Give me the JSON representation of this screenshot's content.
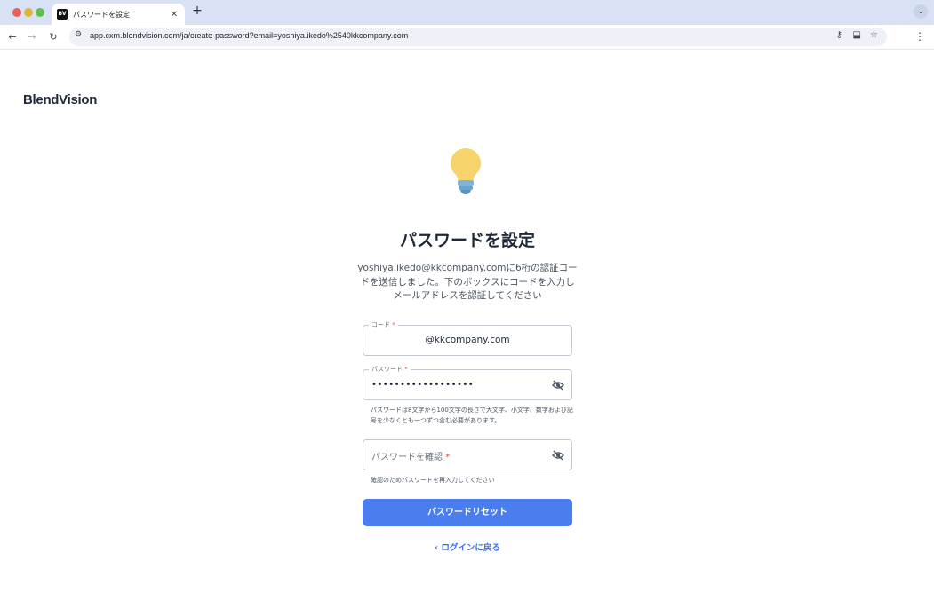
{
  "browser": {
    "tab_title": "パスワードを設定",
    "favicon_text": "BV",
    "url": "app.cxm.blendvision.com/ja/create-password?email=yoshiya.ikedo%2540kkcompany.com"
  },
  "page": {
    "logo": "BlendVision",
    "title": "パスワードを設定",
    "description": "yoshiya.ikedo@kkcompany.comに6桁の認証コードを送信しました。下のボックスにコードを入力しメールアドレスを認証してください",
    "code_field": {
      "label": "コード",
      "value": "@kkcompany.com"
    },
    "password_field": {
      "label": "パスワード",
      "value": "••••••••••••••••••",
      "helper": "パスワードは8文字から100文字の長さで大文字、小文字、数字および記号を少なくとも一つずつ含む必要があります。"
    },
    "confirm_field": {
      "placeholder": "パスワードを確認",
      "helper": "確認のためパスワードを再入力してください"
    },
    "submit_label": "パスワードリセット",
    "back_link": "ログインに戻る"
  },
  "icons": [
    "close-icon",
    "plus-icon",
    "back-arrow-icon",
    "forward-arrow-icon",
    "reload-icon",
    "site-settings-icon",
    "key-icon",
    "install-icon",
    "star-icon",
    "more-vert-icon",
    "lightbulb-icon",
    "eye-off-icon",
    "chevron-left-icon"
  ],
  "colors": {
    "primary": "#4a7dee",
    "link": "#3b6fe8",
    "required": "#ef4444",
    "bulb_yellow": "#f6d36b",
    "bulb_base": "#7fb4d8"
  }
}
